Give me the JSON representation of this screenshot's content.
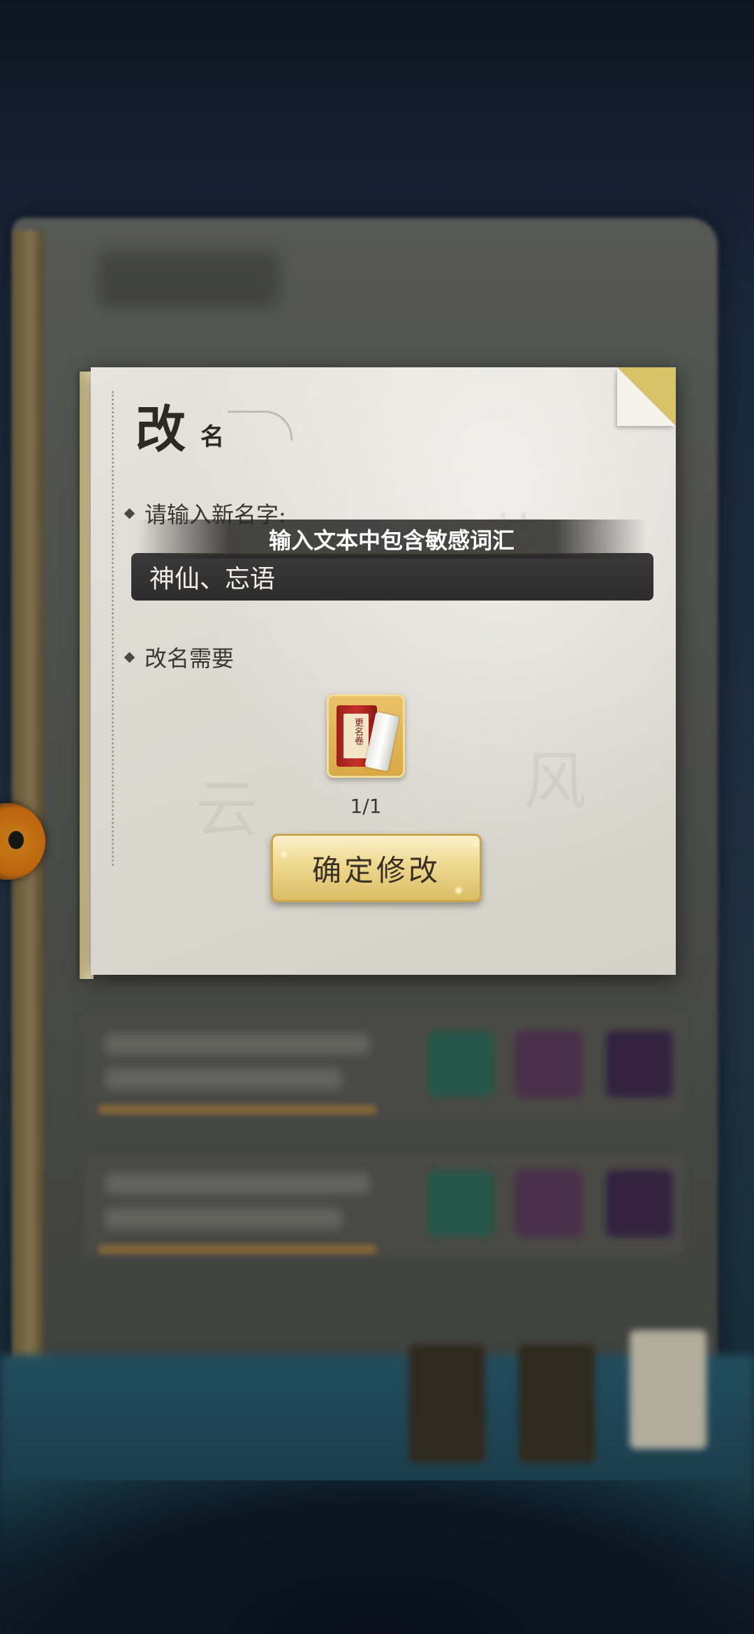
{
  "dialog": {
    "title_main": "改",
    "title_sub": "名",
    "new_name_label": "请输入新名字:",
    "name_input_value": "神仙、忘语",
    "error_toast": "输入文本中包含敏感词汇",
    "requirement_label": "改名需要",
    "item": {
      "icon": "rename-scroll-icon",
      "label": "更名卷",
      "count": "1/1"
    },
    "confirm_label": "确定修改"
  },
  "colors": {
    "paper": "#dcdad1",
    "input_bg": "#2c2c2c",
    "button_gold": "#eed98f",
    "toast_bg": "#282828"
  }
}
